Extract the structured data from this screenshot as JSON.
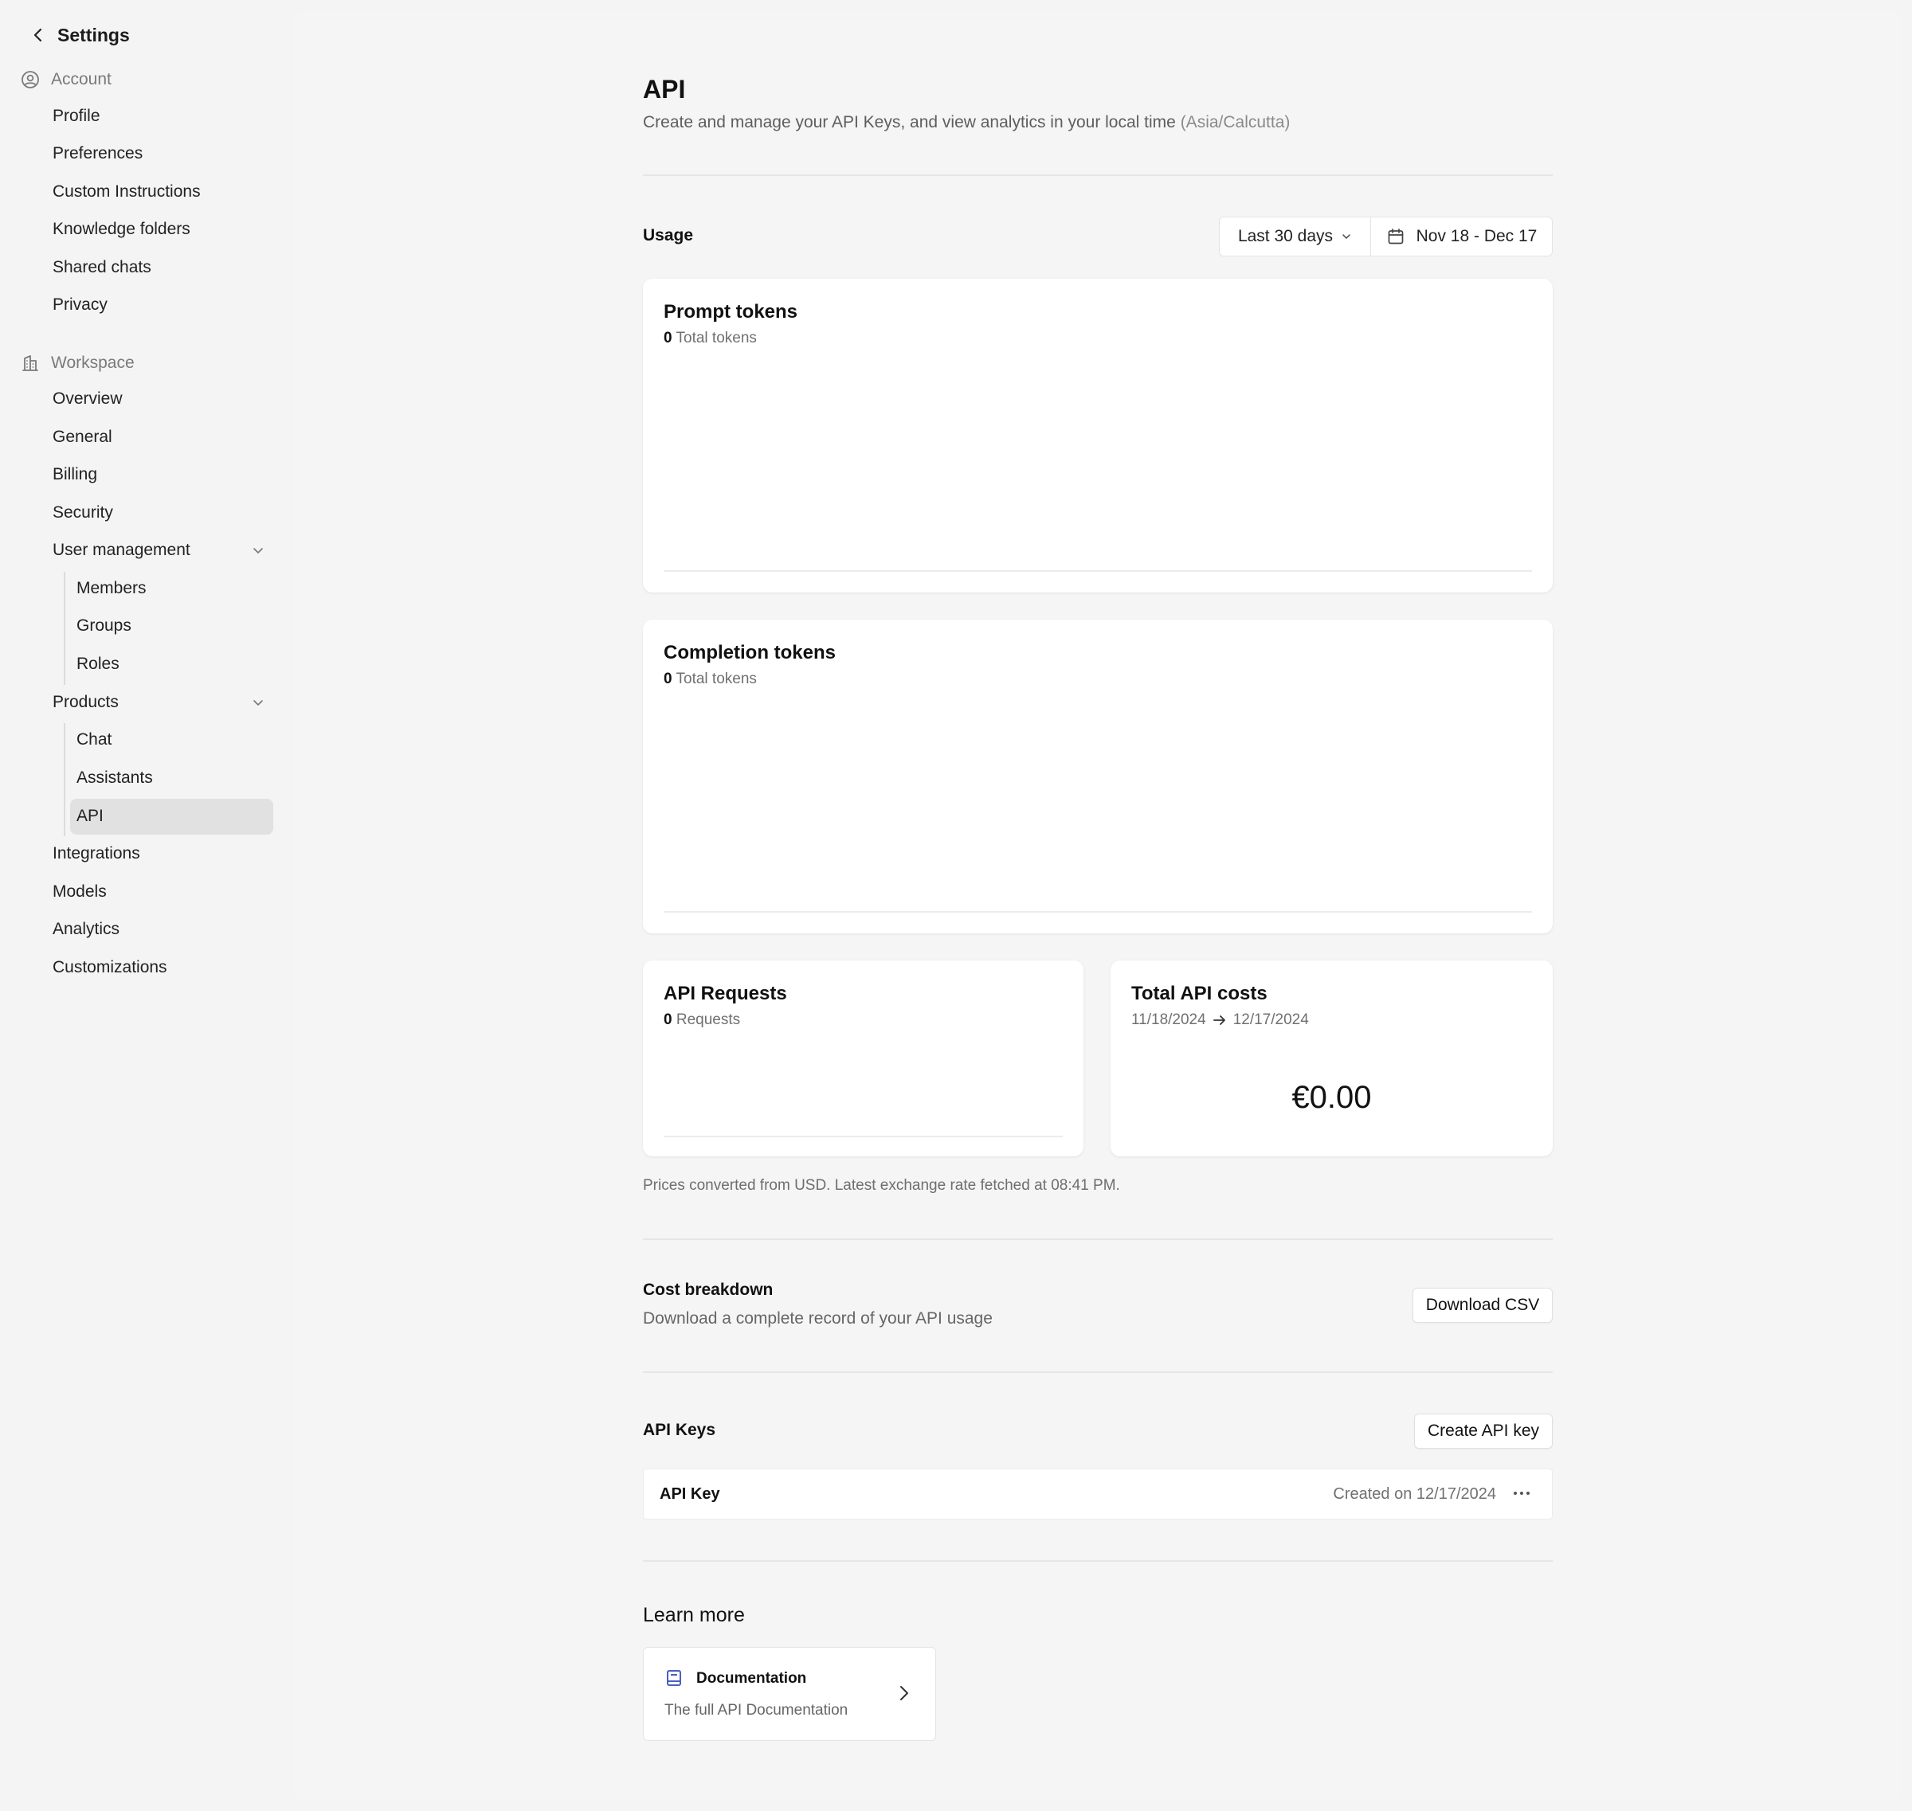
{
  "sidebar": {
    "title": "Settings",
    "account_label": "Account",
    "account_items": [
      "Profile",
      "Preferences",
      "Custom Instructions",
      "Knowledge folders",
      "Shared chats",
      "Privacy"
    ],
    "workspace_label": "Workspace",
    "workspace_items": {
      "overview": "Overview",
      "general": "General",
      "billing": "Billing",
      "security": "Security",
      "user_management": "User management",
      "members": "Members",
      "groups": "Groups",
      "roles": "Roles",
      "products": "Products",
      "chat": "Chat",
      "assistants": "Assistants",
      "api": "API",
      "integrations": "Integrations",
      "models": "Models",
      "analytics": "Analytics",
      "customizations": "Customizations"
    },
    "active_item": "API"
  },
  "header": {
    "title": "API",
    "subtitle": "Create and manage your API Keys, and view analytics in your local time",
    "timezone": "(Asia/Calcutta)"
  },
  "usage": {
    "label": "Usage",
    "range_select": "Last 30 days",
    "date_range": "Nov 18 - Dec 17"
  },
  "cards": {
    "prompt": {
      "title": "Prompt tokens",
      "count": "0",
      "unit": "Total tokens"
    },
    "completion": {
      "title": "Completion tokens",
      "count": "0",
      "unit": "Total tokens"
    },
    "requests": {
      "title": "API Requests",
      "count": "0",
      "unit": "Requests"
    },
    "costs": {
      "title": "Total API costs",
      "start": "11/18/2024",
      "end": "12/17/2024",
      "value": "€0.00"
    }
  },
  "note": "Prices converted from USD. Latest exchange rate fetched at 08:41 PM.",
  "cost_breakdown": {
    "title": "Cost breakdown",
    "subtitle": "Download a complete record of your API usage",
    "button": "Download CSV"
  },
  "api_keys": {
    "label": "API Keys",
    "create_button": "Create API key",
    "rows": [
      {
        "name": "API Key",
        "created": "Created on 12/17/2024"
      }
    ]
  },
  "learn_more": {
    "title": "Learn more",
    "doc_title": "Documentation",
    "doc_sub": "The full API Documentation"
  },
  "colors": {
    "page_bg": "#f4f4f4",
    "card_bg": "#ffffff",
    "active_bg": "#e1e1e1",
    "doc_icon": "#4a5fc1"
  }
}
